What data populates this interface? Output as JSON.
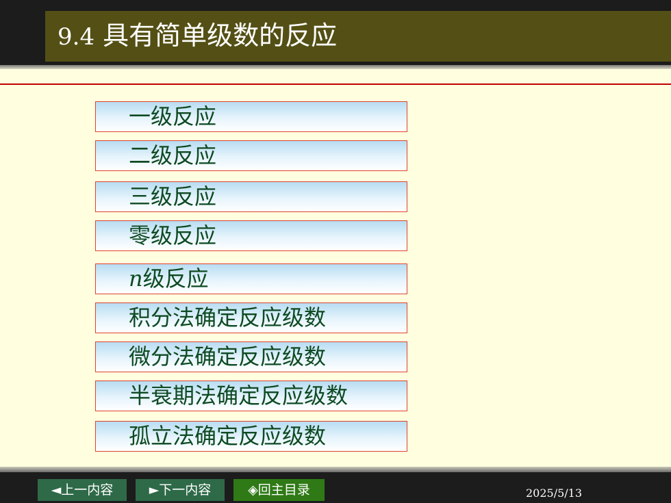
{
  "title": {
    "number": "9.4",
    "text": "具有简单级数的反应"
  },
  "menu": [
    {
      "label": "一级反应"
    },
    {
      "label": "二级反应"
    },
    {
      "label": "三级反应"
    },
    {
      "label": "零级反应"
    },
    {
      "label_prefix": "n",
      "label": "级反应"
    },
    {
      "label": "积分法确定反应级数"
    },
    {
      "label": "微分法确定反应级数"
    },
    {
      "label": "半衰期法确定反应级数"
    },
    {
      "label": "孤立法确定反应级数"
    }
  ],
  "nav": {
    "prev": "◄上一内容",
    "next": "►下一内容",
    "home": "◈回主目录"
  },
  "footer": {
    "date": "2025/5/13"
  },
  "colors": {
    "background": "#ffffe0",
    "title_bar": "#545015",
    "menu_text": "#0e4a22",
    "menu_border": "#e0402a",
    "rule": "#c00000",
    "nav_button": "#2f6a48",
    "home_button": "#2f7a16"
  }
}
